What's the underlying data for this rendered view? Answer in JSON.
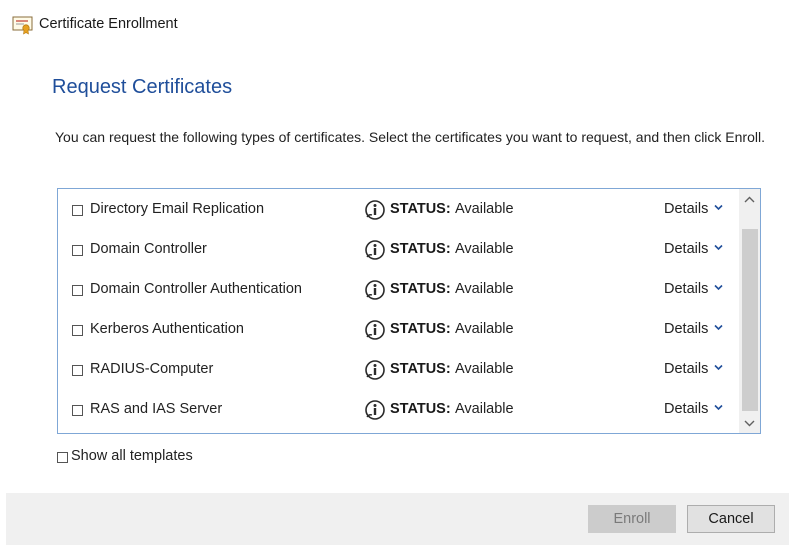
{
  "window": {
    "title": "Certificate Enrollment",
    "icon": "certificate-icon"
  },
  "page": {
    "heading": "Request Certificates",
    "intro": "You can request the following types of certificates. Select the certificates you want to request, and then click Enroll."
  },
  "certificates": [
    {
      "name": "Directory Email Replication",
      "checked": false,
      "status_label": "STATUS:",
      "status": "Available",
      "details_label": "Details"
    },
    {
      "name": "Domain Controller",
      "checked": false,
      "status_label": "STATUS:",
      "status": "Available",
      "details_label": "Details"
    },
    {
      "name": "Domain Controller Authentication",
      "checked": false,
      "status_label": "STATUS:",
      "status": "Available",
      "details_label": "Details"
    },
    {
      "name": "Kerberos Authentication",
      "checked": false,
      "status_label": "STATUS:",
      "status": "Available",
      "details_label": "Details"
    },
    {
      "name": "RADIUS-Computer",
      "checked": false,
      "status_label": "STATUS:",
      "status": "Available",
      "details_label": "Details"
    },
    {
      "name": "RAS and IAS Server",
      "checked": false,
      "status_label": "STATUS:",
      "status": "Available",
      "details_label": "Details"
    }
  ],
  "options": {
    "show_all_templates_label": "Show all templates",
    "show_all_templates_checked": false
  },
  "buttons": {
    "enroll_label": "Enroll",
    "enroll_enabled": false,
    "cancel_label": "Cancel"
  },
  "colors": {
    "heading": "#1f4e9a",
    "list_border": "#7fa7d6",
    "footer_bg": "#f0f0f0"
  }
}
